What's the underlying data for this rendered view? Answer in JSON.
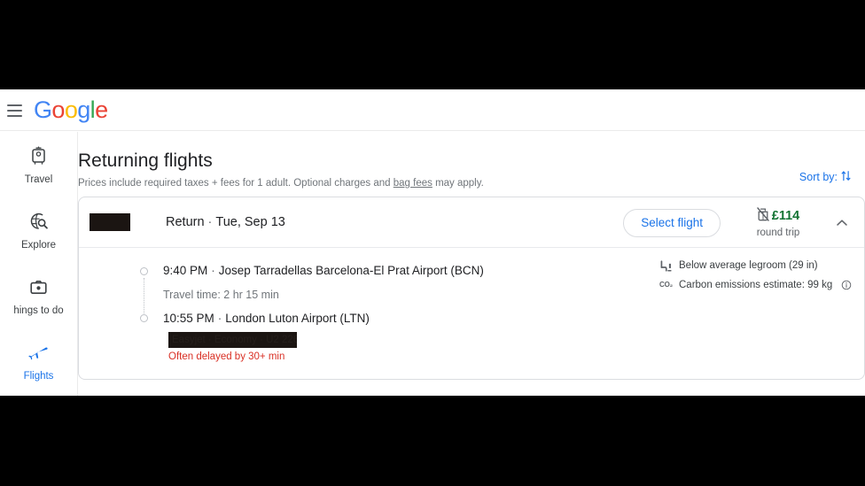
{
  "appbar": {
    "menu_icon": "hamburger-menu-icon",
    "logo_letters": [
      "G",
      "o",
      "o",
      "g",
      "l",
      "e"
    ],
    "logo_text": "Google"
  },
  "sidebar": {
    "items": [
      {
        "label": "Travel",
        "icon": "luggage-icon",
        "active": false
      },
      {
        "label": "Explore",
        "icon": "globe-search-icon",
        "active": false
      },
      {
        "label": "hings to do",
        "icon": "camera-icon",
        "active": false
      },
      {
        "label": "Flights",
        "icon": "airplane-icon",
        "active": true
      }
    ]
  },
  "page": {
    "title": "Returning flights",
    "subtitle_before": "Prices include required taxes + fees for 1 adult. Optional charges and ",
    "subtitle_link": "bag fees",
    "subtitle_after": " may apply.",
    "sort_label": "Sort by:",
    "sort_icon": "sort-arrows-icon",
    "accent_color": "#1a73e8"
  },
  "flight_card": {
    "airline_logo": "redacted-airline-logo",
    "direction": "Return",
    "separator": "·",
    "date": "Tue, Sep 13",
    "select_button": "Select flight",
    "bag_icon": "no-carry-on-bag-icon",
    "price": "£114",
    "price_caption": "round trip",
    "price_color": "#137333",
    "collapse_icon": "chevron-up-icon",
    "itinerary": {
      "depart_time": "9:40 PM",
      "depart_airport": "Josep Tarradellas Barcelona-El Prat Airport (BCN)",
      "travel_time": "Travel time: 2 hr 15 min",
      "arrive_time": "10:55 PM",
      "arrive_airport": "London Luton Airport (LTN)"
    },
    "details_redacted": "Easyjet · Economy · U2 2268",
    "delay_note": "Often delayed by 30+ min",
    "delay_color": "#d93025",
    "amenities": [
      {
        "icon": "legroom-icon",
        "text": "Below average legroom (29 in)"
      },
      {
        "icon": "co2-icon",
        "text": "Carbon emissions estimate: 99 kg",
        "info_icon": "info-circle-icon"
      }
    ]
  }
}
